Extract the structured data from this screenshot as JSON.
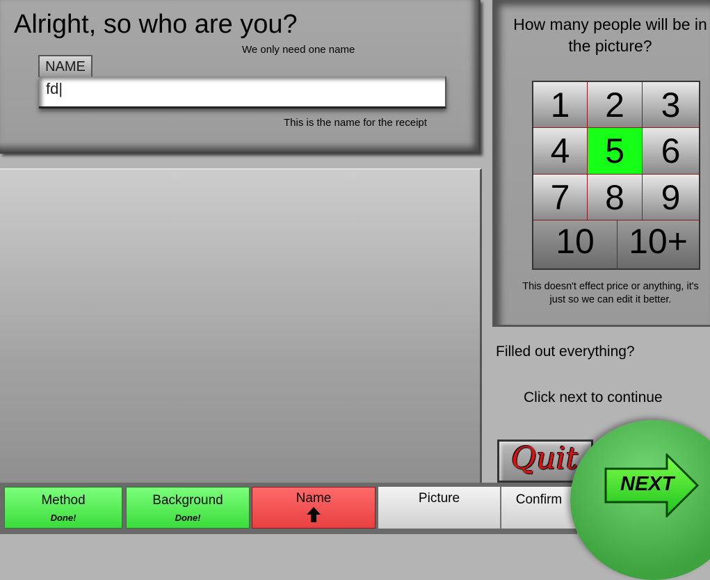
{
  "name_section": {
    "title": "Alright, so who are you?",
    "hint": "We only need one name",
    "field_tag": "NAME",
    "name_value": "fd|",
    "receipt_hint": "This is the name for the receipt"
  },
  "people_section": {
    "title": "How many people will be in the picture?",
    "options": [
      "1",
      "2",
      "3",
      "4",
      "5",
      "6",
      "7",
      "8",
      "9",
      "10",
      "10+"
    ],
    "selected": "5",
    "note": "This doesn't effect price or anything, it's just so we can edit it better."
  },
  "footer_prompt": {
    "question": "Filled out everything?",
    "instruction": "Click next to continue"
  },
  "buttons": {
    "quit": "Quit",
    "next": "NEXT"
  },
  "steps": [
    {
      "label": "Method",
      "status": "Done!"
    },
    {
      "label": "Background",
      "status": "Done!"
    },
    {
      "label": "Name",
      "status": ""
    },
    {
      "label": "Picture",
      "status": ""
    },
    {
      "label": "Confirm",
      "status": ""
    }
  ],
  "colors": {
    "selected_number": "#16ff16",
    "step_done": "#4fe84f",
    "step_active": "#f05050",
    "quit_text": "#d21414",
    "next_button": "#4fbf4f"
  },
  "icons": {
    "current_step": "arrow-up-icon",
    "next": "arrow-right-icon"
  }
}
